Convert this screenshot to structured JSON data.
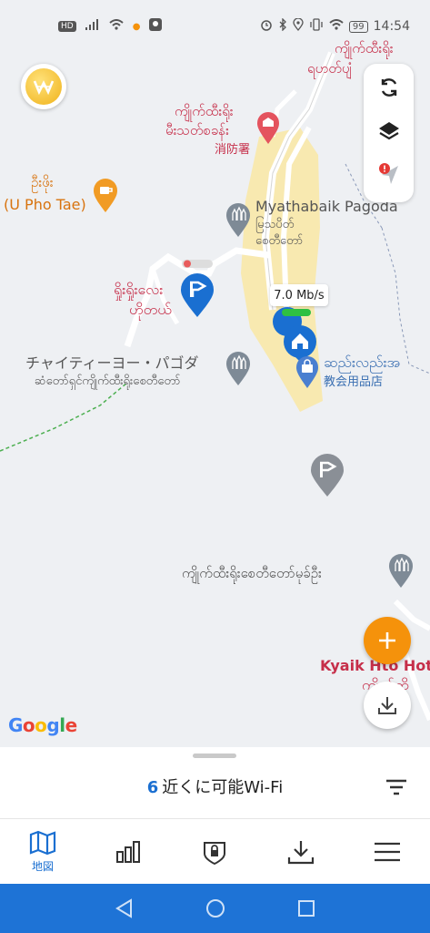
{
  "status_bar": {
    "left": {
      "hd": "HD"
    },
    "right": {
      "battery": "99",
      "time": "14:54"
    }
  },
  "map": {
    "labels": {
      "top_right_1": "ကျိုက်ထီးရိုး",
      "top_right_2": "ရဟတ်ပျံ",
      "fire_station_my_1": "ကျိုက်ထီးရိုး",
      "fire_station_my_2": "မီးသတ်စခန်း",
      "fire_station_jp": "消防署",
      "u_pho_my": "ဦးဖိုး",
      "u_pho_en": "(U Pho Tae)",
      "pagoda_en": "Myathabaik Pagoda",
      "pagoda_my_1": "မြသပိတ်",
      "pagoda_my_2": "စေတီတော်",
      "hotel_my_1": "ရှိုးရှိုးလေး",
      "hotel_my_2": "ဟိုတယ်",
      "chaitiyo_jp": "チャイティーヨー・パゴダ",
      "chaitiyo_my": "ဆံတော်ရှင်ကျိုက်ထီးရိုးစေတီတော်",
      "church_my": "ဆည်းလည်းအ",
      "church_jp": "教会用品店",
      "stupa_entrance": "ကျိုက်ထီးရိုးစေတီတော်မုခ်ဦး",
      "hotel_right_en": "Kyaik Hto Hote",
      "hotel_right_my": "ကျိုက်ထို"
    },
    "speed": "7.0 Mb/s",
    "google": "Google"
  },
  "sheet": {
    "wifi_count": "6",
    "wifi_text": "近くに可能Wi-Fi"
  },
  "bottom_nav": {
    "map_label": "地図"
  },
  "colors": {
    "accent": "#1a6fd1",
    "fab": "#f5920b",
    "system_nav": "#1e73d6"
  },
  "icons": [
    "coin-icon",
    "refresh-icon",
    "layers-icon",
    "location-arrow-icon",
    "add-icon",
    "download-icon",
    "filter-icon",
    "map-icon",
    "stats-icon",
    "vpn-shield-icon",
    "nav-download-icon",
    "menu-icon",
    "back-icon",
    "home-icon",
    "recent-icon"
  ]
}
